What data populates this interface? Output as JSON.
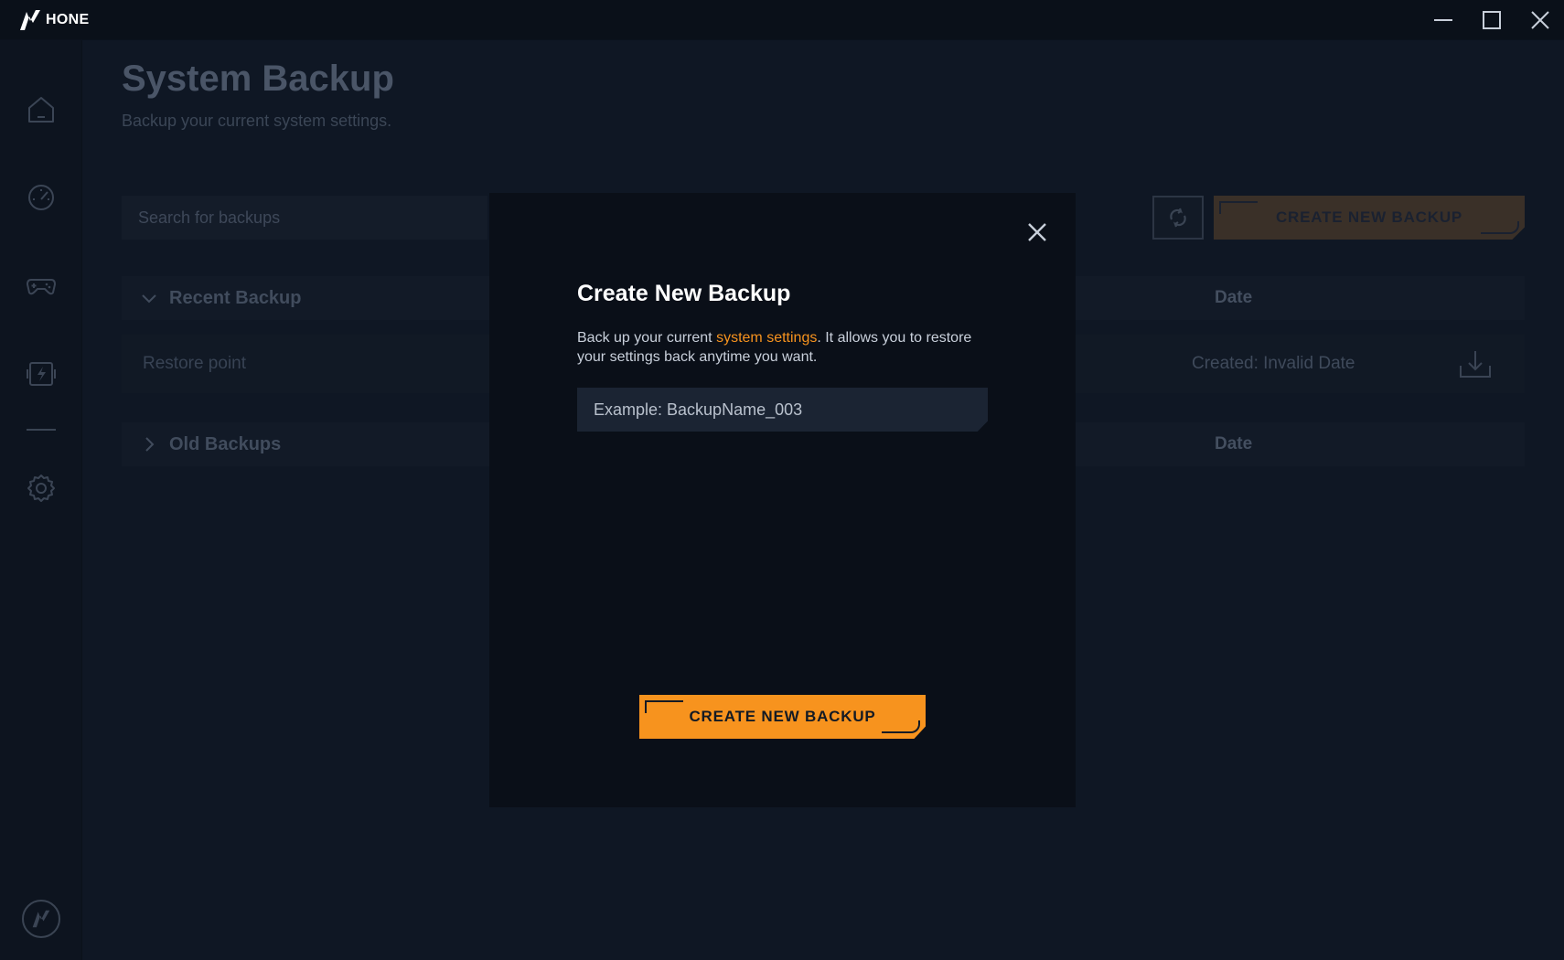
{
  "titlebar": {
    "app_name": "HONE",
    "logo_icon": "hone-logo-icon",
    "controls": [
      "minimize-icon",
      "maximize-icon",
      "close-icon"
    ]
  },
  "sidebar": {
    "items": [
      {
        "icon": "home-icon"
      },
      {
        "icon": "speedometer-icon"
      },
      {
        "icon": "gamepad-icon"
      },
      {
        "icon": "battery-bolt-icon"
      },
      {
        "icon": "gear-icon"
      }
    ],
    "bottom_icon": "hone-logo-icon"
  },
  "page": {
    "title": "System Backup",
    "subtitle": "Backup your current system settings.",
    "search_placeholder": "Search for backups",
    "refresh_icon": "refresh-icon",
    "create_button": "CREATE NEW BACKUP"
  },
  "sections": {
    "recent": {
      "label": "Recent Backup",
      "date_header": "Date",
      "expanded": true
    },
    "old": {
      "label": "Old Backups",
      "date_header": "Date",
      "expanded": false
    }
  },
  "recent_backups": [
    {
      "name": "Restore point",
      "created": "Created: Invalid Date",
      "action_icon": "download-icon"
    }
  ],
  "modal": {
    "title": "Create New Backup",
    "text_before": "Back up your current ",
    "text_accent": "system settings",
    "text_after": ". It allows you to restore your settings back anytime you want.",
    "input_placeholder": "Example: BackupName_003",
    "input_value": "",
    "create_button": "CREATE NEW BACKUP",
    "close_icon": "close-icon"
  },
  "colors": {
    "accent": "#f7931e",
    "background": "#0f1724",
    "modal_background": "#0a0f18"
  }
}
